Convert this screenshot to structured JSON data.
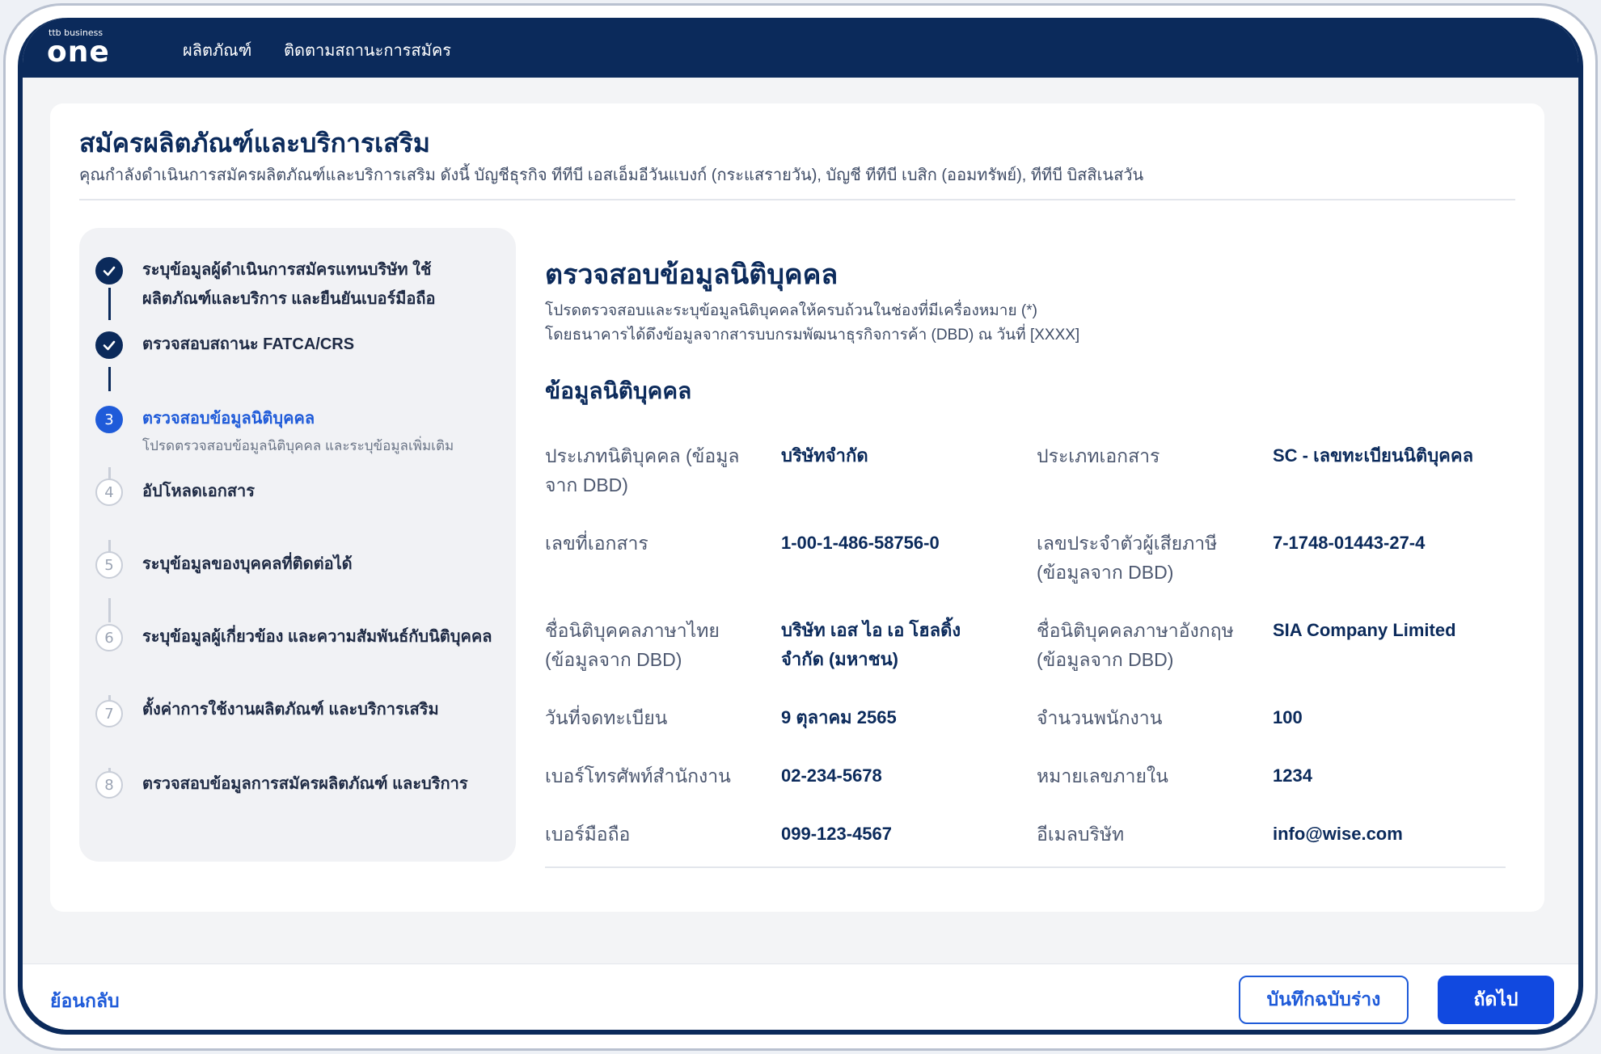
{
  "app": {
    "logo_small": "ttb business",
    "logo_big": "one"
  },
  "nav": {
    "items": [
      "ผลิตภัณฑ์",
      "ติดตามสถานะการสมัคร"
    ]
  },
  "page": {
    "title": "สมัครผลิตภัณฑ์และบริการเสริม",
    "subtitle": "คุณกำลังดำเนินการสมัครผลิตภัณฑ์และบริการเสริม ดังนี้  บัญชีธุรกิจ ทีทีบี เอสเอ็มอีวันแบงก์ (กระแสรายวัน),  บัญชี ทีทีบี เบสิก (ออมทรัพย์),  ทีทีบี บิสสิเนสวัน"
  },
  "steps": [
    {
      "number": "1",
      "status": "done",
      "title": "ระบุข้อมูลผู้ดำเนินการสมัครแทนบริษัท ใช้ผลิตภัณฑ์และบริการ และยืนยันเบอร์มือถือ",
      "desc": ""
    },
    {
      "number": "2",
      "status": "done",
      "title": "ตรวจสอบสถานะ FATCA/CRS",
      "desc": ""
    },
    {
      "number": "3",
      "status": "active",
      "title": "ตรวจสอบข้อมูลนิติบุคคล",
      "desc": "โปรดตรวจสอบข้อมูลนิติบุคคล และระบุข้อมูลเพิ่มเติม"
    },
    {
      "number": "4",
      "status": "todo",
      "title": "อัปโหลดเอกสาร",
      "desc": ""
    },
    {
      "number": "5",
      "status": "todo",
      "title": "ระบุข้อมูลของบุคคลที่ติดต่อได้",
      "desc": ""
    },
    {
      "number": "6",
      "status": "todo",
      "title": "ระบุข้อมูลผู้เกี่ยวข้อง และความสัมพันธ์กับนิติบุคคล",
      "desc": ""
    },
    {
      "number": "7",
      "status": "todo",
      "title": "ตั้งค่าการใช้งานผลิตภัณฑ์ และบริการเสริม",
      "desc": ""
    },
    {
      "number": "8",
      "status": "todo",
      "title": "ตรวจสอบข้อมูลการสมัครผลิตภัณฑ์ และบริการ",
      "desc": ""
    }
  ],
  "content": {
    "title": "ตรวจสอบข้อมูลนิติบุคคล",
    "desc_line1": "โปรดตรวจสอบและระบุข้อมูลนิติบุคคลให้ครบถ้วนในช่องที่มีเครื่องหมาย (*)",
    "desc_line2": "โดยธนาคารได้ดึงข้อมูลจากสารบบกรมพัฒนาธุรกิจการค้า (DBD) ณ วันที่ [XXXX]",
    "section_title": "ข้อมูลนิติบุคคล",
    "fields": [
      {
        "label": "ประเภทนิติบุคคล (ข้อมูลจาก DBD)",
        "value": "บริษัทจำกัด"
      },
      {
        "label": "ประเภทเอกสาร",
        "value": "SC - เลขทะเบียนนิติบุคคล"
      },
      {
        "label": "เลขที่เอกสาร",
        "value": "1-00-1-486-58756-0"
      },
      {
        "label": "เลขประจำตัวผู้เสียภาษี (ข้อมูลจาก DBD)",
        "value": "7-1748-01443-27-4"
      },
      {
        "label": "ชื่อนิติบุคคลภาษาไทย (ข้อมูลจาก DBD)",
        "value": "บริษัท เอส ไอ เอ โฮลดิ้ง จำกัด (มหาชน)"
      },
      {
        "label": "ชื่อนิติบุคคลภาษาอังกฤษ (ข้อมูลจาก DBD)",
        "value": "SIA Company Limited"
      },
      {
        "label": "วันที่จดทะเบียน",
        "value": "9 ตุลาคม 2565"
      },
      {
        "label": "จำนวนพนักงาน",
        "value": "100"
      },
      {
        "label": "เบอร์โทรศัพท์สำนักงาน",
        "value": "02-234-5678"
      },
      {
        "label": "หมายเลขภายใน",
        "value": "1234"
      },
      {
        "label": "เบอร์มือถือ",
        "value": "099-123-4567"
      },
      {
        "label": "อีเมลบริษัท",
        "value": "info@wise.com"
      }
    ]
  },
  "footer": {
    "back_label": "ย้อนกลับ",
    "draft_label": "บันทึกฉบับร่าง",
    "next_label": "ถัดไป"
  },
  "colors": {
    "navy": "#0b2a5b",
    "accent_blue": "#1f5bd9",
    "primary_button": "#1149e0"
  }
}
